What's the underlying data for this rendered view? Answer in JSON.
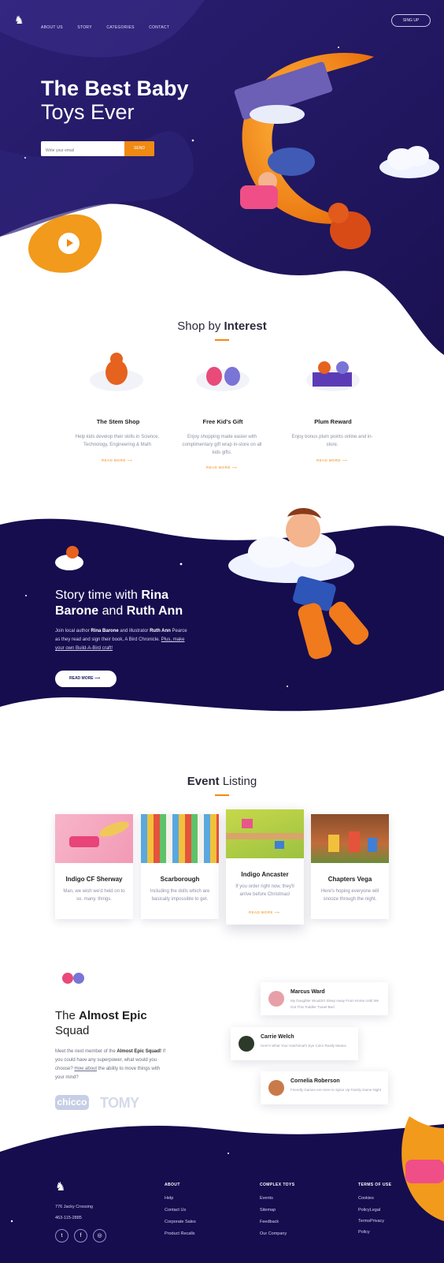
{
  "nav": {
    "items": [
      "ABOUT US",
      "STORY",
      "CATEGORIES",
      "CONTACT"
    ],
    "signup": "SING UP"
  },
  "hero": {
    "title_bold": "The Best Baby",
    "title_light": "Toys Ever",
    "email_placeholder": "Write your email",
    "send": "SEND"
  },
  "interest": {
    "title_light": "Shop by ",
    "title_bold": "Interest",
    "cards": [
      {
        "title": "The Stem Shop",
        "text": "Help kids develop their skills in Science, Technology, Engineering & Math",
        "link": "READ MORE"
      },
      {
        "title": "Free Kid's Gift",
        "text": "Enjoy shopping made easier with complimentary gift wrap in-store on all kids gifts.",
        "link": "READ MORE"
      },
      {
        "title": "Plum Reward",
        "text": "Enjoy bonus plum points online and in-store.",
        "link": "READ MORE"
      }
    ]
  },
  "story": {
    "t1": "Story time with ",
    "t2": "Rina Barone",
    "t3": " and ",
    "t4": "Ruth Ann",
    "p1": "Join local author ",
    "p2": "Rina Barone",
    "p3": " and illustrator ",
    "p4": "Ruth Ann",
    "p5": " Pearce as they read and sign their book, A Bird Chronicle. ",
    "p6": "Plus, make your own Build-A-Bird craft!",
    "button": "READ MORE"
  },
  "events": {
    "title_bold": "Event",
    "title_light": " Listing",
    "items": [
      {
        "title": "Indigo CF Sherway",
        "text": "Man, we wish we'd held on to so. many. things."
      },
      {
        "title": "Scarborough",
        "text": "Including the dolls which are basically impossible to get."
      },
      {
        "title": "Indigo Ancaster",
        "text": "If you order right now, they'll arrive before Christmas!",
        "link": "READ MORE"
      },
      {
        "title": "Chapters Vega",
        "text": "Here's hoping everyone will snooze through the night."
      }
    ]
  },
  "squad": {
    "t1": "The ",
    "t2": "Almost Epic",
    "t3": "Squad",
    "p1": "Meet the next member of the ",
    "p2": "Almost Epic Squad!",
    "p3": " If you could have any superpower, what would you choose? ",
    "p4": "How about",
    "p5": " the ability to move things with your mind?",
    "brands": [
      "chicco",
      "TOMY"
    ],
    "reviews": [
      {
        "name": "Marcus Ward",
        "text": "My Daughter Wouldn't Sleep Away From Home Until We Got This Toddler Travel Bed"
      },
      {
        "name": "Carrie Welch",
        "text": "Here's What Your Hatchimal's Eye Color Really Means"
      },
      {
        "name": "Cornelia Roberson",
        "text": "Friendly Games Are Here to Spice Up Family Game Night"
      }
    ]
  },
  "footer": {
    "address": "776 Jacky Crossing",
    "phone": "463-115-2885",
    "columns": [
      {
        "heading": "ABOUT",
        "links": [
          "Help",
          "Contact Us",
          "Corporate Sales",
          "Product Recalls"
        ]
      },
      {
        "heading": "COMPLEX TOYS",
        "links": [
          "Events",
          "Sitemap",
          "Feedback",
          "Our Company"
        ]
      },
      {
        "heading": "TERMS OF USE",
        "links": [
          "Cookies",
          "PolicyLegal",
          "TermsPrivacy",
          "Policy"
        ]
      }
    ]
  },
  "colors": {
    "navy": "#1c1456",
    "deep": "#130d4a",
    "accent": "#f08a13"
  }
}
